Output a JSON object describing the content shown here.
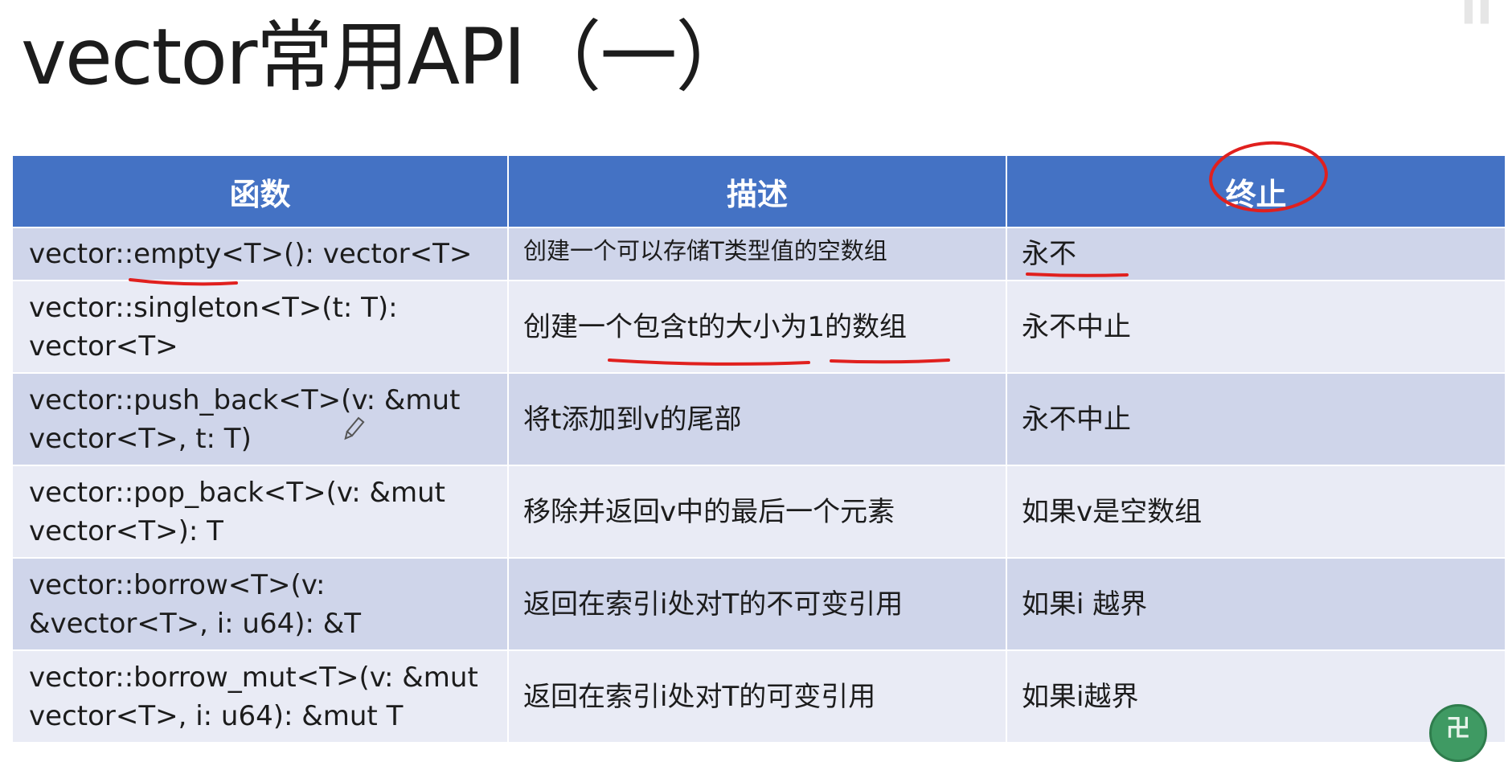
{
  "slide": {
    "title": "vector常用API（一）"
  },
  "table": {
    "headers": {
      "function": "函数",
      "description": "描述",
      "abort": "终止"
    },
    "rows": [
      {
        "function": "vector::empty<T>(): vector<T>",
        "description": "创建一个可以存储T类型值的空数组",
        "abort": "永不"
      },
      {
        "function": "vector::singleton<T>(t: T): vector<T>",
        "description": "创建一个包含t的大小为1的数组",
        "abort": "永不中止"
      },
      {
        "function": "vector::push_back<T>(v: &mut vector<T>, t: T)",
        "description": "将t添加到v的尾部",
        "abort": "永不中止"
      },
      {
        "function": "vector::pop_back<T>(v: &mut vector<T>): T",
        "description": "移除并返回v中的最后一个元素",
        "abort": "如果v是空数组"
      },
      {
        "function": "vector::borrow<T>(v: &vector<T>, i: u64): &T",
        "description": "返回在索引i处对T的不可变引用",
        "abort": "如果i 越界"
      },
      {
        "function": "vector::borrow_mut<T>(v: &mut vector<T>, i: u64): &mut T",
        "description": "返回在索引i处对T的可变引用",
        "abort": "如果i越界"
      }
    ]
  },
  "colors": {
    "header_bg": "#4472c4",
    "row_dark": "#cfd5ea",
    "row_light": "#e9ebf5",
    "annotation": "#e0201e"
  },
  "icons": {
    "logo": "channel-logo-icon",
    "pen": "pen-cursor-icon"
  }
}
